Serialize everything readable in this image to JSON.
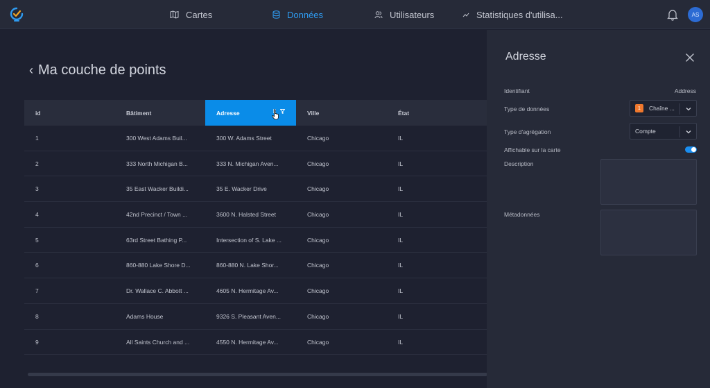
{
  "nav": {
    "items": [
      {
        "label": "Cartes",
        "icon": "map-icon",
        "active": false
      },
      {
        "label": "Données",
        "icon": "database-icon",
        "active": true
      },
      {
        "label": "Utilisateurs",
        "icon": "users-icon",
        "active": false
      },
      {
        "label": "Statistiques d'utilisa...",
        "icon": "chart-line-icon",
        "active": false
      }
    ],
    "avatar_initials": "AS"
  },
  "page": {
    "title": "Ma couche de points"
  },
  "table": {
    "columns": [
      "id",
      "Bâtiment",
      "Adresse",
      "Ville",
      "État"
    ],
    "active_column": "Adresse",
    "rows": [
      [
        "1",
        "300 West Adams Buil...",
        "300 W. Adams Street",
        "Chicago",
        "IL"
      ],
      [
        "2",
        "333 North Michigan B...",
        "333 N. Michigan Aven...",
        "Chicago",
        "IL"
      ],
      [
        "3",
        "35 East Wacker Buildi...",
        "35 E. Wacker Drive",
        "Chicago",
        "IL"
      ],
      [
        "4",
        "42nd Precinct / Town ...",
        "3600 N. Halsted Street",
        "Chicago",
        "IL"
      ],
      [
        "5",
        "63rd Street Bathing P...",
        "Intersection of S. Lake ...",
        "Chicago",
        "IL"
      ],
      [
        "6",
        "860-880 Lake Shore D...",
        "860-880 N. Lake Shor...",
        "Chicago",
        "IL"
      ],
      [
        "7",
        "Dr. Wallace C. Abbott ...",
        "4605 N. Hermitage Av...",
        "Chicago",
        "IL"
      ],
      [
        "8",
        "Adams House",
        "9326 S. Pleasant Aven...",
        "Chicago",
        "IL"
      ],
      [
        "9",
        "All Saints Church and ...",
        "4550 N. Hermitage Av...",
        "Chicago",
        "IL"
      ]
    ]
  },
  "panel": {
    "title": "Adresse",
    "identifier_label": "Identifiant",
    "identifier_value": "Address",
    "data_type_label": "Type de données",
    "data_type_value": "Chaîne ...",
    "data_type_badge": "1",
    "aggregation_label": "Type d'agrégation",
    "aggregation_value": "Compte",
    "displayable_label": "Affichable sur la carte",
    "displayable_on": true,
    "description_label": "Description",
    "description_value": "",
    "metadata_label": "Métadonnées",
    "metadata_value": ""
  },
  "colors": {
    "background": "#1e2130",
    "panel": "#262a38",
    "accent": "#0a8ce8",
    "badge": "#f0782d"
  }
}
